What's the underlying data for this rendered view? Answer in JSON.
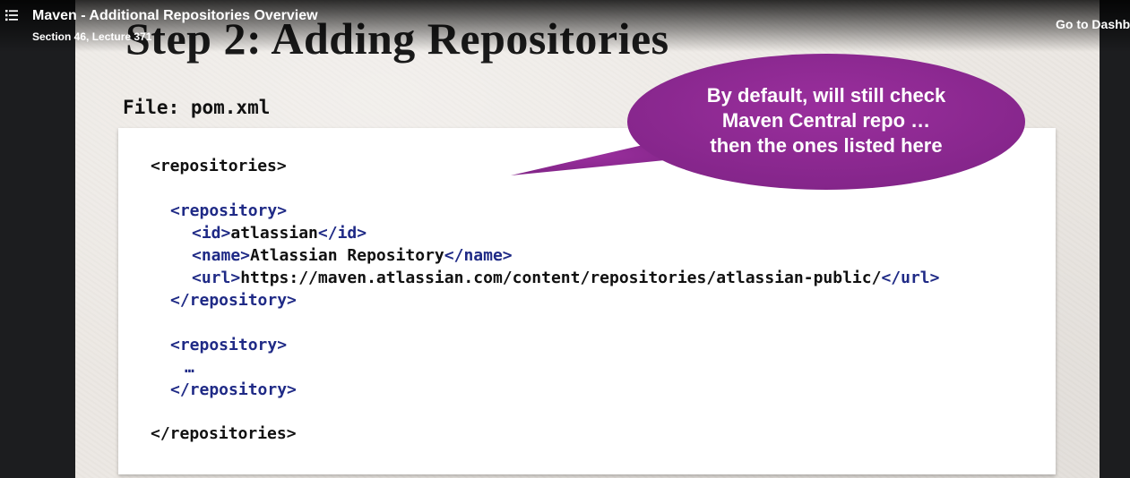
{
  "player": {
    "lecture_title": "Maven - Additional Repositories Overview",
    "lecture_subtitle": "Section 46, Lecture 371",
    "dashboard_link": "Go to Dashb",
    "menu_icon": "list-menu-icon"
  },
  "slide": {
    "title": "Step 2: Adding Repositories",
    "file_label": "File: pom.xml",
    "callout": {
      "color": "#8e2a91",
      "lines": [
        "By default, will still check",
        "Maven Central repo …",
        "then the ones listed here"
      ]
    },
    "code": {
      "repositories_open": "<repositories>",
      "repo1_open": "<repository>",
      "id_open": "<id>",
      "id_value": "atlassian",
      "id_close": "</id>",
      "name_open": "<name>",
      "name_value": "Atlassian Repository",
      "name_close": "</name>",
      "url_open": "<url>",
      "url_value": "https://maven.atlassian.com/content/repositories/atlassian-public/",
      "url_close": "</url>",
      "repo1_close": "</repository>",
      "repo2_open": "<repository>",
      "ellipsis": "…",
      "repo2_close": "</repository>",
      "repositories_close": "</repositories>"
    }
  }
}
